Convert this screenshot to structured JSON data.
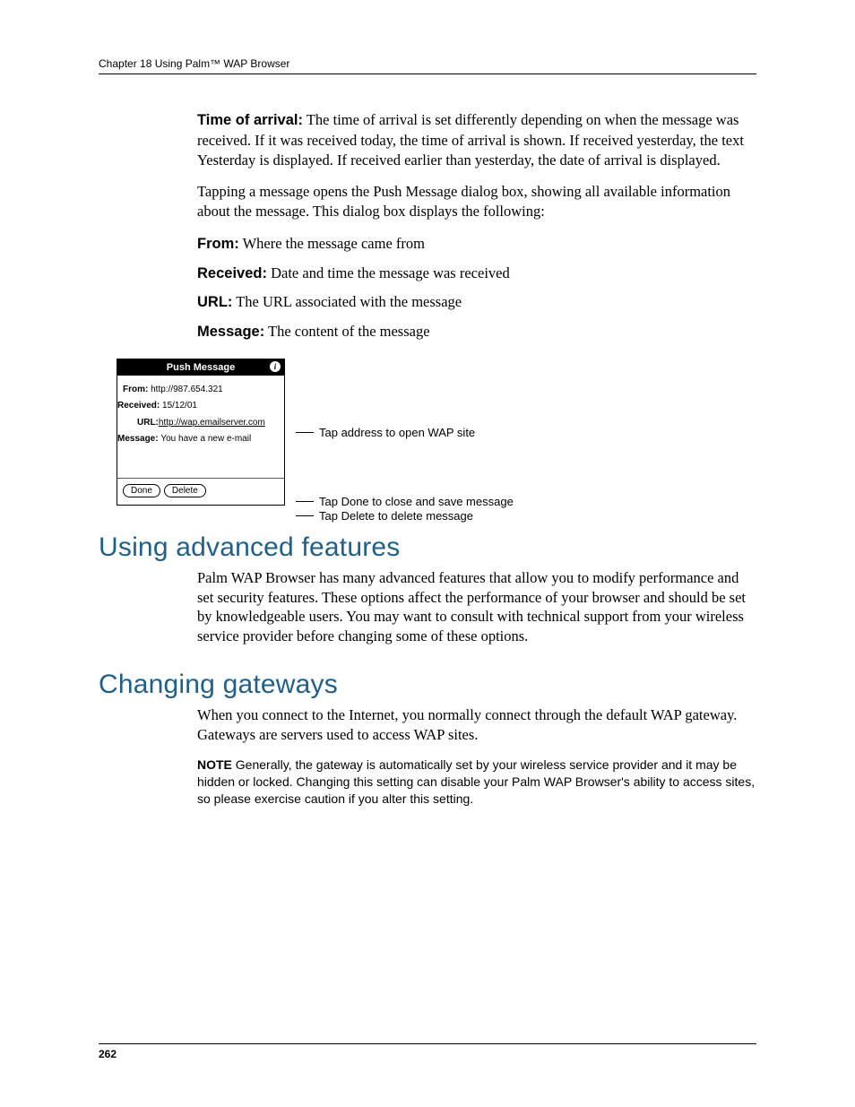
{
  "header": {
    "chapter_line": "Chapter 18   Using Palm™ WAP Browser"
  },
  "time_of_arrival": {
    "label": "Time of arrival:",
    "text": " The time of arrival is set differently depending on when the message was received. If it was received today, the time of arrival is shown. If received yesterday, the text Yesterday is displayed. If received earlier than yesterday, the date of arrival is displayed."
  },
  "tap_para": "Tapping a message opens the Push Message dialog box, showing all available information about the message. This dialog box displays the following:",
  "fields": {
    "from_label": "From:",
    "from_text": " Where the message came from",
    "received_label": "Received:",
    "received_text": " Date and time the message was received",
    "url_label": "URL:",
    "url_text": " The URL associated with the message",
    "message_label": "Message:",
    "message_text": " The content of the message"
  },
  "dialog": {
    "title": "Push Message",
    "from_label": "From: ",
    "from_value": "http://987.654.321",
    "received_label": "Received: ",
    "received_value": "15/12/01",
    "url_label": "URL:",
    "url_value": "http://wap.emailserver.com",
    "msg_label": "Message: ",
    "msg_value": "You have a new e-mail",
    "done_label": "Done",
    "delete_label": "Delete"
  },
  "callouts": {
    "a": "Tap address to open WAP site",
    "b": "Tap Done to close and save message",
    "c": "Tap Delete to delete message"
  },
  "sections": {
    "advanced_title": "Using advanced features",
    "advanced_para": "Palm WAP Browser has many advanced features that allow you to modify performance and set security features. These options affect the performance of your browser and should be set by knowledgeable users. You may want to consult with technical support from your wireless service provider before changing some of these options.",
    "gateways_title": "Changing gateways",
    "gateways_para": "When you connect to the Internet, you normally connect through the default WAP gateway. Gateways are servers used to access WAP sites.",
    "note_label": "NOTE",
    "note_text": "   Generally, the gateway is automatically set by your wireless service provider and it may be hidden or locked. Changing this setting can disable your Palm WAP Browser's ability to access sites, so please exercise caution if you alter this setting."
  },
  "footer": {
    "page_number": "262"
  }
}
